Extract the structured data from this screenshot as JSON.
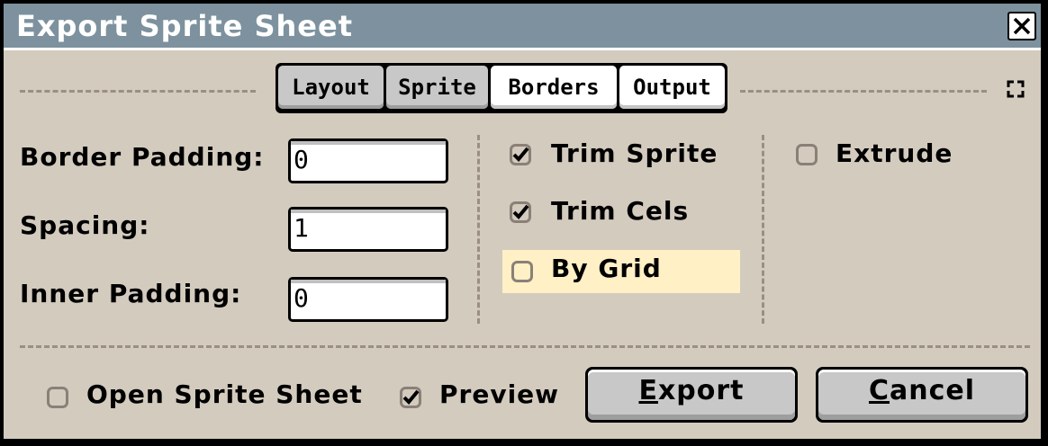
{
  "window": {
    "title": "Export Sprite Sheet"
  },
  "tabs": [
    {
      "label": "Layout",
      "selected": true
    },
    {
      "label": "Sprite",
      "selected": true
    },
    {
      "label": "Borders",
      "selected": false
    },
    {
      "label": "Output",
      "selected": false
    }
  ],
  "borders": {
    "border_padding_label": "Border Padding:",
    "border_padding_value": "0",
    "spacing_label": "Spacing:",
    "spacing_value": "1",
    "inner_padding_label": "Inner Padding:",
    "inner_padding_value": "0"
  },
  "trim": {
    "trim_sprite_label": "Trim Sprite",
    "trim_sprite_checked": true,
    "trim_cels_label": "Trim Cels",
    "trim_cels_checked": true,
    "by_grid_label": "By Grid",
    "by_grid_checked": false
  },
  "extrude": {
    "label": "Extrude",
    "checked": false
  },
  "footer": {
    "open_sprite_sheet_label": "Open Sprite Sheet",
    "open_sprite_sheet_checked": false,
    "preview_label": "Preview",
    "preview_checked": true,
    "export_mnemonic": "E",
    "export_rest": "xport",
    "cancel_mnemonic": "C",
    "cancel_rest": "ancel"
  },
  "colors": {
    "titlebar": "#7d929e",
    "window_bg": "#d3cbbe",
    "highlight": "#fff0c5",
    "separator": "#9b8f83"
  }
}
